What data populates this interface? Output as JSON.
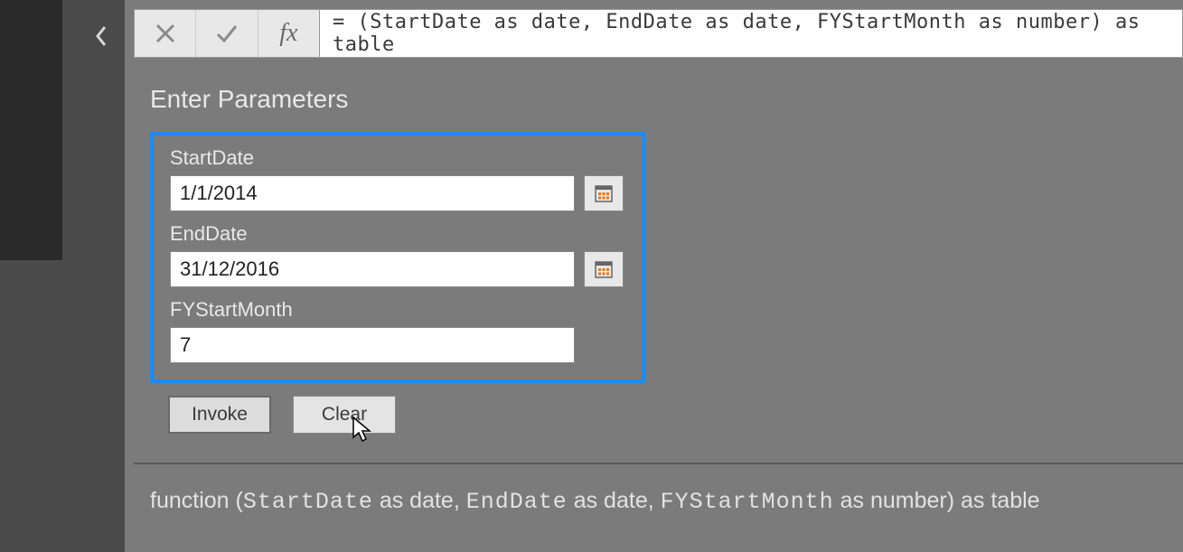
{
  "formula": {
    "expression": "= (StartDate as date, EndDate as date, FYStartMonth as number) as table"
  },
  "section": {
    "title": "Enter Parameters"
  },
  "params": {
    "startDate": {
      "label": "StartDate",
      "value": "1/1/2014"
    },
    "endDate": {
      "label": "EndDate",
      "value": "31/12/2016"
    },
    "fyStartMonth": {
      "label": "FYStartMonth",
      "value": "7"
    }
  },
  "buttons": {
    "invoke": "Invoke",
    "clear": "Clear"
  },
  "signature": {
    "prefix": "function (",
    "p1": "StartDate",
    "t1": " as date, ",
    "p2": "EndDate",
    "t2": " as date, ",
    "p3": "FYStartMonth",
    "t3": " as number) as table"
  }
}
